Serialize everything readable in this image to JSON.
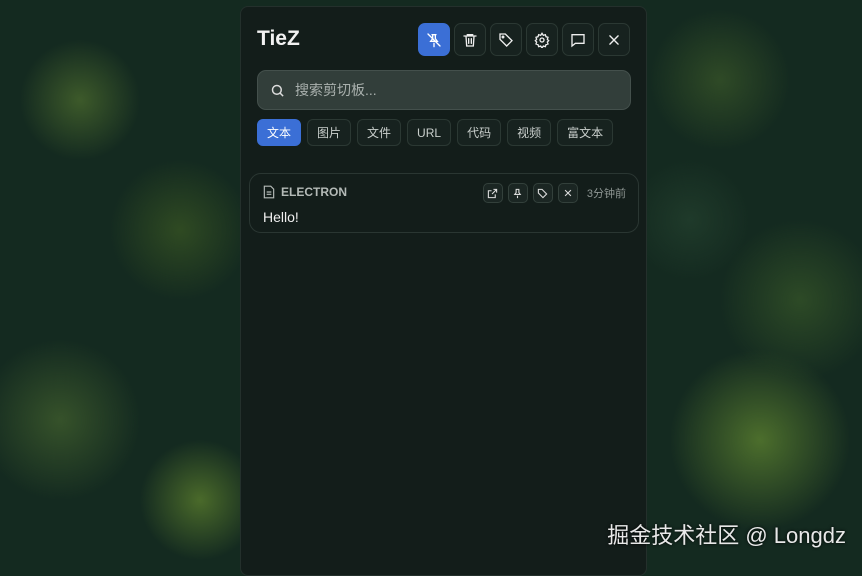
{
  "app": {
    "title": "TieZ"
  },
  "toolbar": [
    {
      "name": "unpin-button",
      "icon": "pin-off-icon",
      "active": true
    },
    {
      "name": "delete-button",
      "icon": "trash-icon"
    },
    {
      "name": "tag-button",
      "icon": "tag-icon"
    },
    {
      "name": "settings-button",
      "icon": "gear-icon"
    },
    {
      "name": "feedback-button",
      "icon": "message-icon"
    },
    {
      "name": "close-button",
      "icon": "close-icon"
    }
  ],
  "search": {
    "placeholder": "搜索剪切板..."
  },
  "filters": [
    "文本",
    "图片",
    "文件",
    "URL",
    "代码",
    "视频",
    "富文本"
  ],
  "active_filter": "文本",
  "items": [
    {
      "source": "ELECTRON",
      "content": "Hello!",
      "time": "3分钟前"
    }
  ],
  "watermark": "掘金技术社区 @ Longdz",
  "colors": {
    "accent": "#3b6fd6",
    "panel": "#131d1a"
  }
}
